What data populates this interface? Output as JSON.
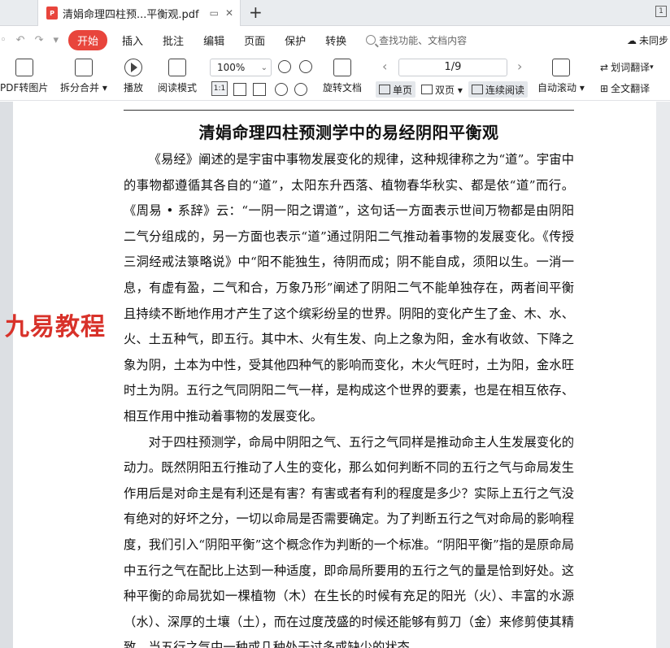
{
  "tab": {
    "title": "清娟命理四柱预...平衡观.pdf",
    "pdf_badge": "P"
  },
  "menu": {
    "start": "开始",
    "items": [
      "插入",
      "批注",
      "编辑",
      "页面",
      "保护",
      "转换"
    ],
    "search_placeholder": "查找功能、文档内容",
    "sync": "未同步"
  },
  "toolbar": {
    "pdf_to_image": "PDF转图片",
    "split_merge": "拆分合并",
    "play": "播放",
    "read_mode": "阅读模式",
    "zoom": "100%",
    "one_to_one": "1:1",
    "rotate": "旋转文档",
    "page_indicator": "1/9",
    "single_page": "单页",
    "double_page": "双页",
    "continuous": "连续阅读",
    "auto_scroll": "自动滚动",
    "word_translate": "划词翻译",
    "full_translate": "全文翻译"
  },
  "document": {
    "title": "清娟命理四柱预测学中的易经阴阳平衡观",
    "watermark": "九易教程",
    "paragraphs": [
      "《易经》阐述的是宇宙中事物发展变化的规律，这种规律称之为“道”。宇宙中的事物都遵循其各自的“道”，太阳东升西落、植物春华秋实、都是依“道”而行。《周易 • 系辞》云：“一阴一阳之谓道”，这句话一方面表示世间万物都是由阴阳二气分组成的，另一方面也表示“道”通过阴阳二气推动着事物的发展变化。《传授三洞经戒法箓略说》中“阳不能独生，待阴而成；阴不能自成，须阳以生。一消一息，有虚有盈，二气和合，万象乃形”阐述了阴阳二气不能单独存在，两者间平衡且持续不断地作用才产生了这个缤彩纷呈的世界。阴阳的变化产生了金、木、水、火、土五种气，即五行。其中木、火有生发、向上之象为阳，金水有收敛、下降之象为阴，土本为中性，受其他四种气的影响而变化，木火气旺时，土为阳，金水旺时土为阴。五行之气同阴阳二气一样，是构成这个世界的要素，也是在相互依存、相互作用中推动着事物的发展变化。",
      "对于四柱预测学，命局中阴阳之气、五行之气同样是推动命主人生发展变化的动力。既然阴阳五行推动了人生的变化，那么如何判断不同的五行之气与命局发生作用后是对命主是有利还是有害？有害或者有利的程度是多少？实际上五行之气没有绝对的好坏之分，一切以命局是否需要确定。为了判断五行之气对命局的影响程度，我们引入“阴阳平衡”这个概念作为判断的一个标准。“阴阳平衡”指的是原命局中五行之气在配比上达到一种适度，即命局所要用的五行之气的量是恰到好处。这种平衡的命局犹如一棵植物（木）在生长的时候有充足的阳光（火）、丰富的水源（水）、深厚的土壤（土），而在过度茂盛的时候还能够有剪刀（金）来修剪使其精致。当五行之气中一种或几种处于过多或缺少的状态，"
    ]
  }
}
